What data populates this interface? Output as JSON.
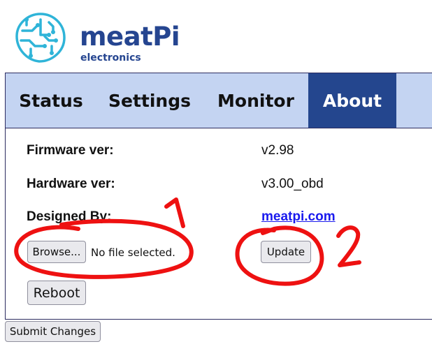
{
  "brand": {
    "name": "meatPi",
    "subtitle": "electronics",
    "primary_color": "#254590",
    "logo_accent_color": "#2fb4d8"
  },
  "tabs": [
    {
      "label": "Status",
      "active": false
    },
    {
      "label": "Settings",
      "active": false
    },
    {
      "label": "Monitor",
      "active": false
    },
    {
      "label": "About",
      "active": true
    }
  ],
  "about": {
    "firmware_label": "Firmware ver:",
    "firmware_value": "v2.98",
    "hardware_label": "Hardware ver:",
    "hardware_value": "v3.00_obd",
    "designed_label": "Designed By:",
    "designed_link": "meatpi.com"
  },
  "upload": {
    "browse_label": "Browse...",
    "file_status": "No file selected.",
    "update_label": "Update"
  },
  "reboot_label": "Reboot",
  "submit_label": "Submit Changes",
  "annotations": {
    "marker_1": "1",
    "marker_2": "2",
    "ink_color": "#ee1111"
  }
}
